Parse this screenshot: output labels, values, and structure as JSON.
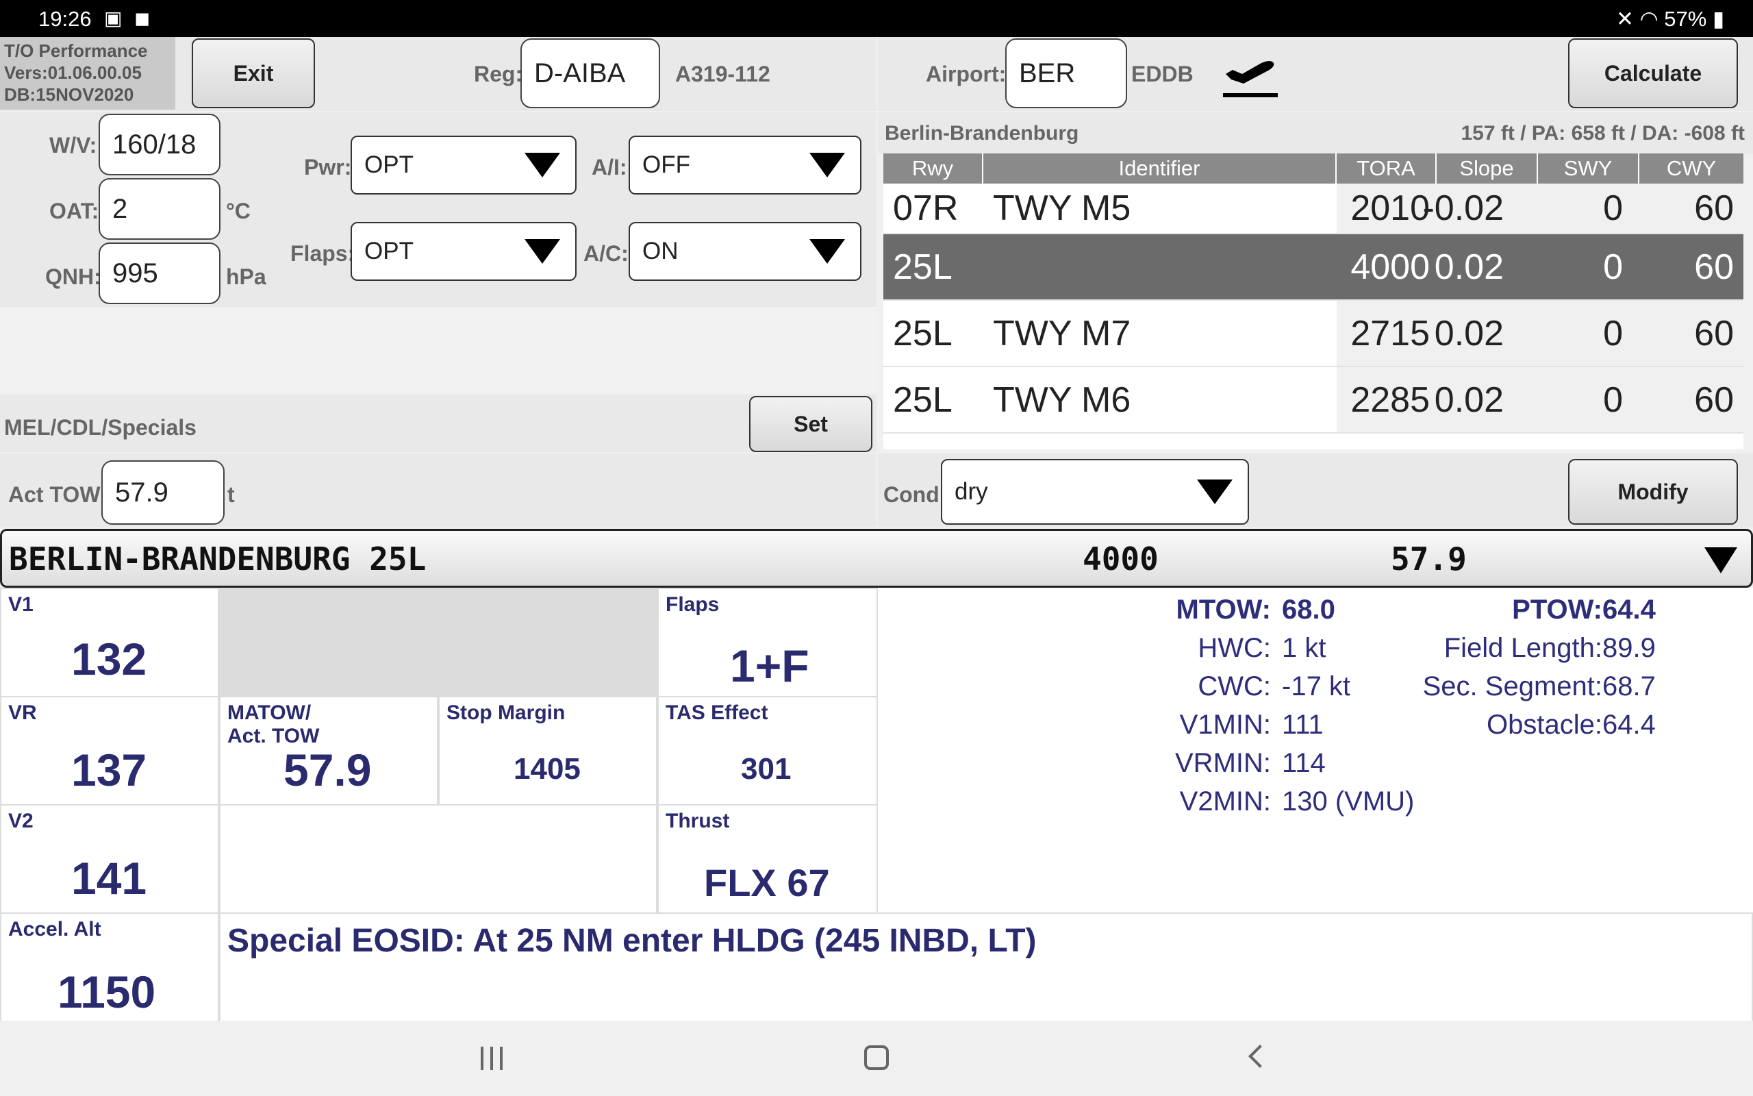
{
  "status": {
    "time": "19:26",
    "battery": "57%"
  },
  "app": {
    "title": "T/O Performance",
    "version": "Vers:01.06.00.05",
    "db": "DB:15NOV2020"
  },
  "toolbar": {
    "exit_label": "Exit",
    "calculate_label": "Calculate",
    "set_label": "Set",
    "modify_label": "Modify"
  },
  "aircraft": {
    "reg_label": "Reg:",
    "reg": "D-AIBA",
    "type": "A319-112"
  },
  "airport": {
    "label": "Airport:",
    "iata": "BER",
    "icao": "EDDB",
    "name": "Berlin-Brandenburg",
    "elevation_info": "157 ft / PA: 658 ft / DA: -608 ft"
  },
  "inputs": {
    "wv_label": "W/V:",
    "wv": "160/18",
    "oat_label": "OAT:",
    "oat": "2",
    "oat_unit": "°C",
    "qnh_label": "QNH:",
    "qnh": "995",
    "qnh_unit": "hPa",
    "pwr_label": "Pwr:",
    "pwr": "OPT",
    "ai_label": "A/I:",
    "ai": "OFF",
    "flaps_label": "Flaps:",
    "flaps": "OPT",
    "ac_label": "A/C:",
    "ac": "ON",
    "mel_label": "MEL/CDL/Specials",
    "tow_label": "Act TOW:",
    "tow": "57.9",
    "tow_unit": "t",
    "cond_label": "Cond:",
    "cond": "dry"
  },
  "runways": {
    "headers": [
      "Rwy",
      "Identifier",
      "TORA",
      "Slope",
      "SWY",
      "CWY"
    ],
    "rows": [
      {
        "rwy": "07R",
        "ident": "TWY M5",
        "tora": "2010",
        "slope": "-0.02",
        "swy": "0",
        "cwy": "60"
      },
      {
        "rwy": "25L",
        "ident": "",
        "tora": "4000",
        "slope": "0.02",
        "swy": "0",
        "cwy": "60"
      },
      {
        "rwy": "25L",
        "ident": "TWY M7",
        "tora": "2715",
        "slope": "0.02",
        "swy": "0",
        "cwy": "60"
      },
      {
        "rwy": "25L",
        "ident": "TWY M6",
        "tora": "2285",
        "slope": "0.02",
        "swy": "0",
        "cwy": "60"
      }
    ]
  },
  "summary": {
    "name": "BERLIN-BRANDENBURG 25L",
    "tora": "4000",
    "tow": "57.9"
  },
  "results": {
    "v1_label": "V1",
    "v1": "132",
    "vr_label": "VR",
    "vr": "137",
    "v2_label": "V2",
    "v2": "141",
    "accel_label": "Accel. Alt",
    "accel": "1150",
    "flaps_label": "Flaps",
    "flaps": "1+F",
    "matow_label1": "MATOW/",
    "matow_label2": "Act. TOW",
    "matow": "57.9",
    "stop_label": "Stop Margin",
    "stop": "1405",
    "tas_label": "TAS Effect",
    "tas": "301",
    "thrust_label": "Thrust",
    "thrust": "FLX 67",
    "special": "Special EOSID: At 25 NM enter HLDG (245 INBD, LT)"
  },
  "details": {
    "mtow_label": "MTOW:",
    "mtow": "68.0",
    "hwc_label": "HWC:",
    "hwc": "1 kt",
    "cwc_label": "CWC:",
    "cwc": "-17 kt",
    "v1min_label": "V1MIN:",
    "v1min": "111",
    "vrmin_label": "VRMIN:",
    "vrmin": "114",
    "v2min_label": "V2MIN:",
    "v2min": "130 (VMU)",
    "ptow_label": "PTOW:",
    "ptow": "64.4",
    "field_label": "Field Length:",
    "field": "89.9",
    "sec_label": "Sec. Segment:",
    "sec": "68.7",
    "obst_label": "Obstacle:",
    "obst": "64.4"
  }
}
